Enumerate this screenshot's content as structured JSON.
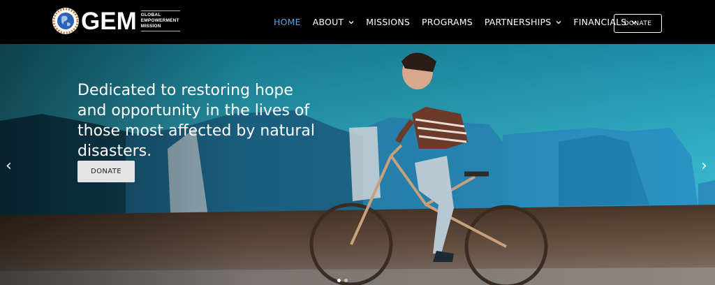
{
  "brand": {
    "logo_text": "GEM",
    "tagline_lines": [
      "GLOBAL",
      "EMPOWERMENT",
      "MISSION"
    ]
  },
  "nav": {
    "items": [
      {
        "label": "HOME",
        "active": true,
        "dropdown": false
      },
      {
        "label": "ABOUT",
        "active": false,
        "dropdown": true
      },
      {
        "label": "MISSIONS",
        "active": false,
        "dropdown": false
      },
      {
        "label": "PROGRAMS",
        "active": false,
        "dropdown": false
      },
      {
        "label": "PARTNERSHIPS",
        "active": false,
        "dropdown": true
      },
      {
        "label": "FINANCIALS",
        "active": false,
        "dropdown": true
      }
    ],
    "donate_label": "DONATE"
  },
  "hero": {
    "headline": "Dedicated to restoring hope and opportunity in the lives of those most affected by natural disasters.",
    "button_label": "DONATE",
    "prev_arrow": "‹",
    "next_arrow": "›",
    "slide_count": 2,
    "active_slide": 0
  },
  "colors": {
    "header_bg": "#000000",
    "nav_active": "#5aa6e0",
    "nav_text": "#ffffff",
    "hero_sky": "#2fa7bf",
    "tarp_blue": "#2a8fc2",
    "ground": "#5a4433"
  },
  "icons": {
    "logo": "globe-emblem-icon",
    "dropdown": "chevron-down-icon",
    "prev": "chevron-left-icon",
    "next": "chevron-right-icon"
  }
}
